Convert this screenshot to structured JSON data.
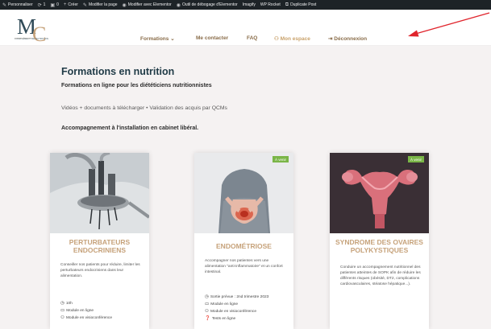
{
  "admin_bar": {
    "items": [
      {
        "icon": "brush-icon",
        "glyph": "✎",
        "label": "Personnaliser"
      },
      {
        "icon": "refresh-icon",
        "glyph": "⟳",
        "label": "1"
      },
      {
        "icon": "comment-icon",
        "glyph": "▣",
        "label": "0"
      },
      {
        "icon": "plus-icon",
        "glyph": "+",
        "label": "Créer"
      },
      {
        "icon": "pencil-icon",
        "glyph": "✎",
        "label": "Modifier la page"
      },
      {
        "icon": "elementor-icon",
        "glyph": "◉",
        "label": "Modifier avec Elementor"
      },
      {
        "icon": "elementor-icon",
        "glyph": "◉",
        "label": "Outil de débogage d'Elementor"
      },
      {
        "icon": "",
        "glyph": "",
        "label": "Imagify"
      },
      {
        "icon": "",
        "glyph": "",
        "label": "WP Rocket"
      },
      {
        "icon": "copy-icon",
        "glyph": "⧉",
        "label": "Duplicate Post"
      }
    ]
  },
  "logo": {
    "letters": "MC",
    "tagline": "COMPLÉMENT DE NUTRITION"
  },
  "nav": {
    "formations": "Formations ⌄",
    "contact": "Me contacter",
    "faq": "FAQ",
    "espace": "Mon espace",
    "logout": "Déconnexion"
  },
  "main": {
    "title": "Formations en nutrition",
    "subtitle": "Formations en ligne pour les diététiciens nutritionnistes",
    "features": "Vidéos + documents à télécharger • Validation des acquis par QCMs",
    "accompaniment": "Accompagnement à l'installation en cabinet libéral."
  },
  "cards": [
    {
      "title": "PERTURBATEURS ENDOCRINIENS",
      "description": "Conseiller nos patients pour réduire, limiter les perturbateurs endocriniens dans leur alimentation.",
      "badge": "",
      "meta": [
        {
          "icon": "clock-icon",
          "glyph": "◷",
          "text": "10h"
        },
        {
          "icon": "monitor-icon",
          "glyph": "▭",
          "text": "Module en ligne"
        },
        {
          "icon": "group-icon",
          "glyph": "⚇",
          "text": "Module en visioconférence"
        }
      ]
    },
    {
      "title": "ENDOMÉTRIOSE",
      "description": "Accompagner nos patientes vers une alimentation \"anti-inflammatoire\" et un confort intestinal.",
      "badge": "À venir",
      "meta": [
        {
          "icon": "clock-icon",
          "glyph": "◷",
          "text": "Sortie prévue : 2nd trimestre 2023"
        },
        {
          "icon": "monitor-icon",
          "glyph": "▭",
          "text": "Module en ligne"
        },
        {
          "icon": "group-icon",
          "glyph": "⚇",
          "text": "Module en visioconférence"
        },
        {
          "icon": "question-icon",
          "glyph": "❓",
          "text": "Tests en ligne"
        }
      ]
    },
    {
      "title": "SYNDROME DES OVAIRES POLYKYSTIQUES",
      "description": "Conduire un accompagnement nutritionnel des patientes atteintes de SOPK afin de réduire les différents risques (obésité, DT2, complications cardiovasculaires, stéatose hépatique...).",
      "badge": "À venir",
      "meta": []
    }
  ],
  "colors": {
    "accent": "#c6a27a",
    "nav": "#8a6d4a",
    "badge": "#7ab547",
    "title": "#1f3a46",
    "arrow": "#e0242c"
  }
}
